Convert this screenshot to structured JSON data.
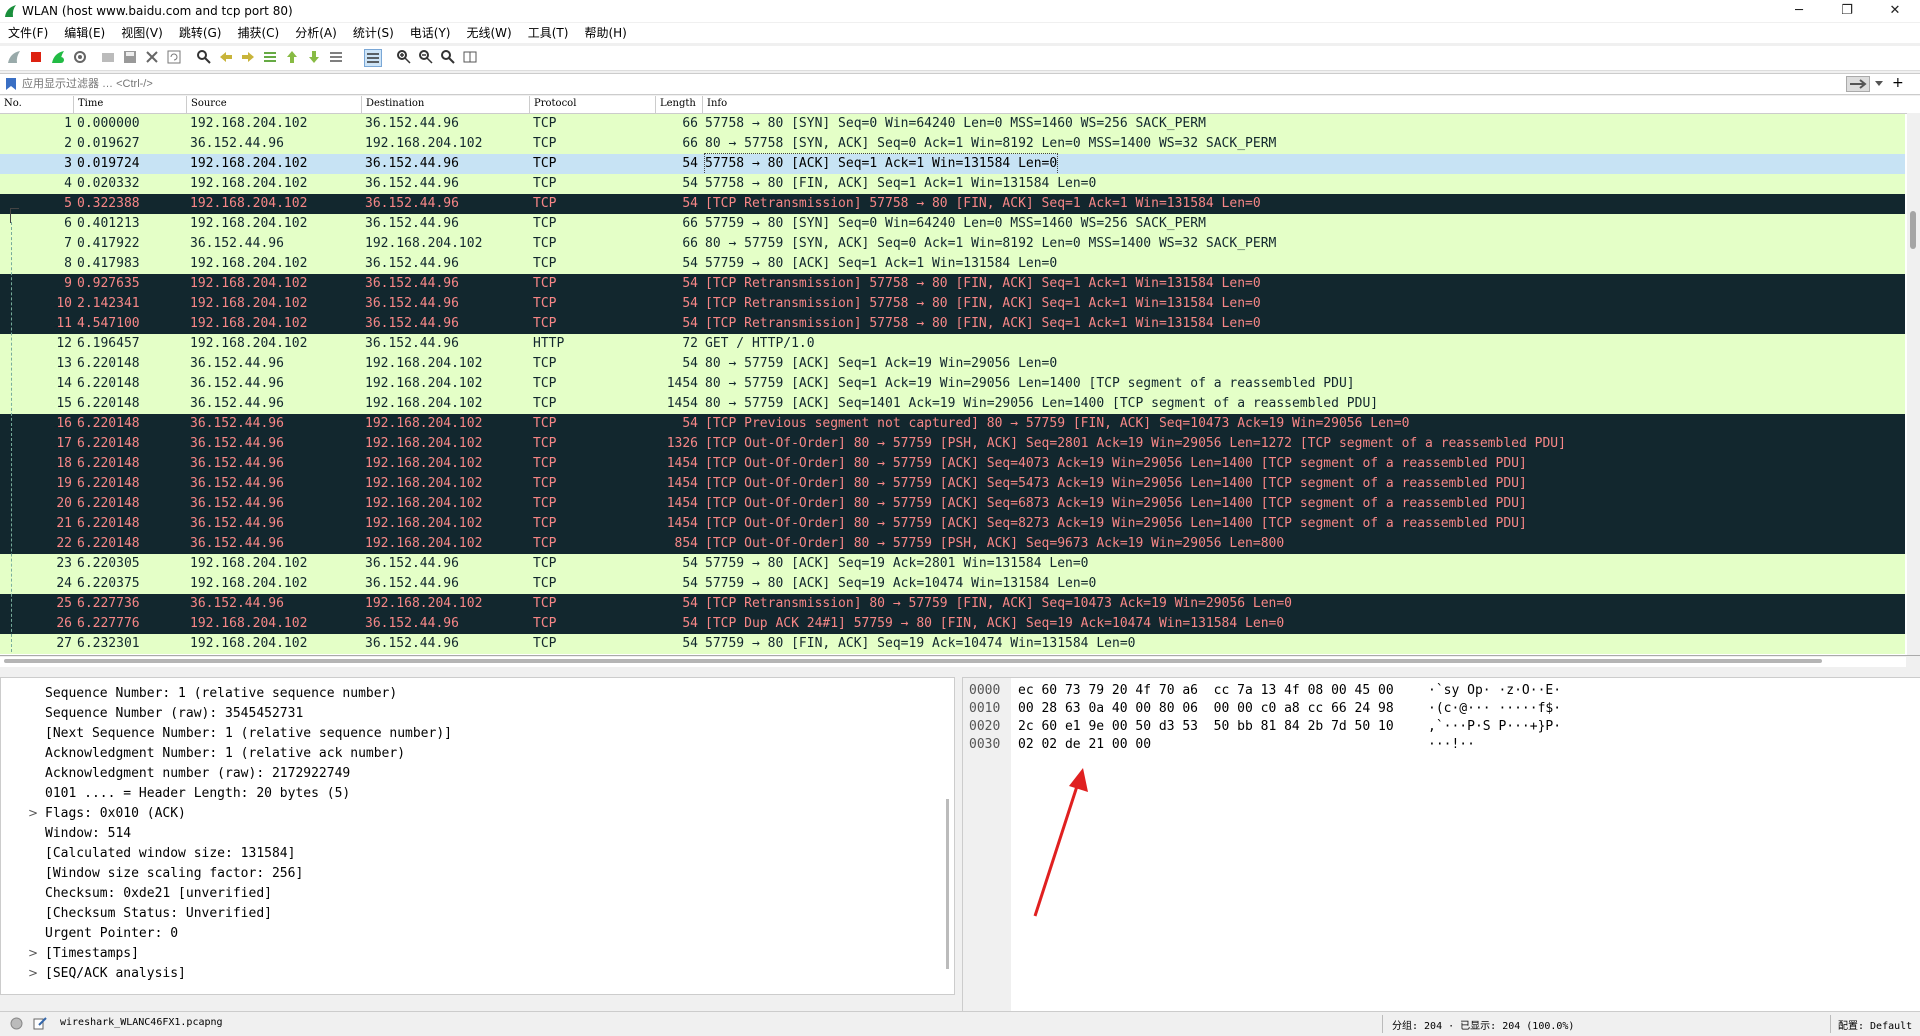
{
  "window": {
    "title": "WLAN (host www.baidu.com and tcp port 80)",
    "minimize": "─",
    "maximize": "❐",
    "close": "✕"
  },
  "menu": [
    "文件(F)",
    "编辑(E)",
    "视图(V)",
    "跳转(G)",
    "捕获(C)",
    "分析(A)",
    "统计(S)",
    "电话(Y)",
    "无线(W)",
    "工具(T)",
    "帮助(H)"
  ],
  "filter": {
    "placeholder": "应用显示过滤器 … <Ctrl-/>",
    "apply_icon": "arrow-right-icon",
    "add": "+"
  },
  "columns": [
    "No.",
    "Time",
    "Source",
    "Destination",
    "Protocol",
    "Length",
    "Info"
  ],
  "packets": [
    {
      "no": "1",
      "time": "0.000000",
      "src": "192.168.204.102",
      "dst": "36.152.44.96",
      "proto": "TCP",
      "len": "66",
      "info": "57758 → 80 [SYN] Seq=0 Win=64240 Len=0 MSS=1460 WS=256 SACK_PERM",
      "type": "ok"
    },
    {
      "no": "2",
      "time": "0.019627",
      "src": "36.152.44.96",
      "dst": "192.168.204.102",
      "proto": "TCP",
      "len": "66",
      "info": "80 → 57758 [SYN, ACK] Seq=0 Ack=1 Win=8192 Len=0 MSS=1400 WS=32 SACK_PERM",
      "type": "ok"
    },
    {
      "no": "3",
      "time": "0.019724",
      "src": "192.168.204.102",
      "dst": "36.152.44.96",
      "proto": "TCP",
      "len": "54",
      "info": "57758 → 80 [ACK] Seq=1 Ack=1 Win=131584 Len=0",
      "type": "ok",
      "selected": true
    },
    {
      "no": "4",
      "time": "0.020332",
      "src": "192.168.204.102",
      "dst": "36.152.44.96",
      "proto": "TCP",
      "len": "54",
      "info": "57758 → 80 [FIN, ACK] Seq=1 Ack=1 Win=131584 Len=0",
      "type": "ok"
    },
    {
      "no": "5",
      "time": "0.322388",
      "src": "192.168.204.102",
      "dst": "36.152.44.96",
      "proto": "TCP",
      "len": "54",
      "info": "[TCP Retransmission] 57758 → 80 [FIN, ACK] Seq=1 Ack=1 Win=131584 Len=0",
      "type": "bad"
    },
    {
      "no": "6",
      "time": "0.401213",
      "src": "192.168.204.102",
      "dst": "36.152.44.96",
      "proto": "TCP",
      "len": "66",
      "info": "57759 → 80 [SYN] Seq=0 Win=64240 Len=0 MSS=1460 WS=256 SACK_PERM",
      "type": "ok"
    },
    {
      "no": "7",
      "time": "0.417922",
      "src": "36.152.44.96",
      "dst": "192.168.204.102",
      "proto": "TCP",
      "len": "66",
      "info": "80 → 57759 [SYN, ACK] Seq=0 Ack=1 Win=8192 Len=0 MSS=1400 WS=32 SACK_PERM",
      "type": "ok"
    },
    {
      "no": "8",
      "time": "0.417983",
      "src": "192.168.204.102",
      "dst": "36.152.44.96",
      "proto": "TCP",
      "len": "54",
      "info": "57759 → 80 [ACK] Seq=1 Ack=1 Win=131584 Len=0",
      "type": "ok"
    },
    {
      "no": "9",
      "time": "0.927635",
      "src": "192.168.204.102",
      "dst": "36.152.44.96",
      "proto": "TCP",
      "len": "54",
      "info": "[TCP Retransmission] 57758 → 80 [FIN, ACK] Seq=1 Ack=1 Win=131584 Len=0",
      "type": "bad"
    },
    {
      "no": "10",
      "time": "2.142341",
      "src": "192.168.204.102",
      "dst": "36.152.44.96",
      "proto": "TCP",
      "len": "54",
      "info": "[TCP Retransmission] 57758 → 80 [FIN, ACK] Seq=1 Ack=1 Win=131584 Len=0",
      "type": "bad"
    },
    {
      "no": "11",
      "time": "4.547100",
      "src": "192.168.204.102",
      "dst": "36.152.44.96",
      "proto": "TCP",
      "len": "54",
      "info": "[TCP Retransmission] 57758 → 80 [FIN, ACK] Seq=1 Ack=1 Win=131584 Len=0",
      "type": "bad"
    },
    {
      "no": "12",
      "time": "6.196457",
      "src": "192.168.204.102",
      "dst": "36.152.44.96",
      "proto": "HTTP",
      "len": "72",
      "info": "GET / HTTP/1.0",
      "type": "ok"
    },
    {
      "no": "13",
      "time": "6.220148",
      "src": "36.152.44.96",
      "dst": "192.168.204.102",
      "proto": "TCP",
      "len": "54",
      "info": "80 → 57759 [ACK] Seq=1 Ack=19 Win=29056 Len=0",
      "type": "ok"
    },
    {
      "no": "14",
      "time": "6.220148",
      "src": "36.152.44.96",
      "dst": "192.168.204.102",
      "proto": "TCP",
      "len": "1454",
      "info": "80 → 57759 [ACK] Seq=1 Ack=19 Win=29056 Len=1400 [TCP segment of a reassembled PDU]",
      "type": "ok"
    },
    {
      "no": "15",
      "time": "6.220148",
      "src": "36.152.44.96",
      "dst": "192.168.204.102",
      "proto": "TCP",
      "len": "1454",
      "info": "80 → 57759 [ACK] Seq=1401 Ack=19 Win=29056 Len=1400 [TCP segment of a reassembled PDU]",
      "type": "ok"
    },
    {
      "no": "16",
      "time": "6.220148",
      "src": "36.152.44.96",
      "dst": "192.168.204.102",
      "proto": "TCP",
      "len": "54",
      "info": "[TCP Previous segment not captured] 80 → 57759 [FIN, ACK] Seq=10473 Ack=19 Win=29056 Len=0",
      "type": "bad"
    },
    {
      "no": "17",
      "time": "6.220148",
      "src": "36.152.44.96",
      "dst": "192.168.204.102",
      "proto": "TCP",
      "len": "1326",
      "info": "[TCP Out-Of-Order] 80 → 57759 [PSH, ACK] Seq=2801 Ack=19 Win=29056 Len=1272 [TCP segment of a reassembled PDU]",
      "type": "bad"
    },
    {
      "no": "18",
      "time": "6.220148",
      "src": "36.152.44.96",
      "dst": "192.168.204.102",
      "proto": "TCP",
      "len": "1454",
      "info": "[TCP Out-Of-Order] 80 → 57759 [ACK] Seq=4073 Ack=19 Win=29056 Len=1400 [TCP segment of a reassembled PDU]",
      "type": "bad"
    },
    {
      "no": "19",
      "time": "6.220148",
      "src": "36.152.44.96",
      "dst": "192.168.204.102",
      "proto": "TCP",
      "len": "1454",
      "info": "[TCP Out-Of-Order] 80 → 57759 [ACK] Seq=5473 Ack=19 Win=29056 Len=1400 [TCP segment of a reassembled PDU]",
      "type": "bad"
    },
    {
      "no": "20",
      "time": "6.220148",
      "src": "36.152.44.96",
      "dst": "192.168.204.102",
      "proto": "TCP",
      "len": "1454",
      "info": "[TCP Out-Of-Order] 80 → 57759 [ACK] Seq=6873 Ack=19 Win=29056 Len=1400 [TCP segment of a reassembled PDU]",
      "type": "bad"
    },
    {
      "no": "21",
      "time": "6.220148",
      "src": "36.152.44.96",
      "dst": "192.168.204.102",
      "proto": "TCP",
      "len": "1454",
      "info": "[TCP Out-Of-Order] 80 → 57759 [ACK] Seq=8273 Ack=19 Win=29056 Len=1400 [TCP segment of a reassembled PDU]",
      "type": "bad"
    },
    {
      "no": "22",
      "time": "6.220148",
      "src": "36.152.44.96",
      "dst": "192.168.204.102",
      "proto": "TCP",
      "len": "854",
      "info": "[TCP Out-Of-Order] 80 → 57759 [PSH, ACK] Seq=9673 Ack=19 Win=29056 Len=800",
      "type": "bad"
    },
    {
      "no": "23",
      "time": "6.220305",
      "src": "192.168.204.102",
      "dst": "36.152.44.96",
      "proto": "TCP",
      "len": "54",
      "info": "57759 → 80 [ACK] Seq=19 Ack=2801 Win=131584 Len=0",
      "type": "ok"
    },
    {
      "no": "24",
      "time": "6.220375",
      "src": "192.168.204.102",
      "dst": "36.152.44.96",
      "proto": "TCP",
      "len": "54",
      "info": "57759 → 80 [ACK] Seq=19 Ack=10474 Win=131584 Len=0",
      "type": "ok"
    },
    {
      "no": "25",
      "time": "6.227736",
      "src": "36.152.44.96",
      "dst": "192.168.204.102",
      "proto": "TCP",
      "len": "54",
      "info": "[TCP Retransmission] 80 → 57759 [FIN, ACK] Seq=10473 Ack=19 Win=29056 Len=0",
      "type": "bad"
    },
    {
      "no": "26",
      "time": "6.227776",
      "src": "192.168.204.102",
      "dst": "36.152.44.96",
      "proto": "TCP",
      "len": "54",
      "info": "[TCP Dup ACK 24#1] 57759 → 80 [FIN, ACK] Seq=19 Ack=10474 Win=131584 Len=0",
      "type": "bad"
    },
    {
      "no": "27",
      "time": "6.232301",
      "src": "192.168.204.102",
      "dst": "36.152.44.96",
      "proto": "TCP",
      "len": "54",
      "info": "57759 → 80 [FIN, ACK] Seq=19 Ack=10474 Win=131584 Len=0",
      "type": "ok"
    }
  ],
  "details": [
    {
      "text": "Sequence Number: 1    (relative sequence number)",
      "expand": ""
    },
    {
      "text": "Sequence Number (raw): 3545452731",
      "expand": ""
    },
    {
      "text": "[Next Sequence Number: 1    (relative sequence number)]",
      "expand": ""
    },
    {
      "text": "Acknowledgment Number: 1    (relative ack number)",
      "expand": ""
    },
    {
      "text": "Acknowledgment number (raw): 2172922749",
      "expand": ""
    },
    {
      "text": "0101 .... = Header Length: 20 bytes (5)",
      "expand": ""
    },
    {
      "text": "Flags: 0x010 (ACK)",
      "expand": ">"
    },
    {
      "text": "Window: 514",
      "expand": ""
    },
    {
      "text": "[Calculated window size: 131584]",
      "expand": ""
    },
    {
      "text": "[Window size scaling factor: 256]",
      "expand": ""
    },
    {
      "text": "Checksum: 0xde21 [unverified]",
      "expand": ""
    },
    {
      "text": "[Checksum Status: Unverified]",
      "expand": ""
    },
    {
      "text": "Urgent Pointer: 0",
      "expand": ""
    },
    {
      "text": "[Timestamps]",
      "expand": ">"
    },
    {
      "text": "[SEQ/ACK analysis]",
      "expand": ">"
    }
  ],
  "bytes": [
    {
      "offset": "0000",
      "hex": "ec 60 73 79 20 4f 70 a6  cc 7a 13 4f 08 00 45 00",
      "ascii": "·`sy Op· ·z·O··E·"
    },
    {
      "offset": "0010",
      "hex": "00 28 63 0a 40 00 80 06  00 00 c0 a8 cc 66 24 98",
      "ascii": "·(c·@··· ·····f$·"
    },
    {
      "offset": "0020",
      "hex": "2c 60 e1 9e 00 50 d3 53  50 bb 81 84 2b 7d 50 10",
      "ascii": ",`···P·S P···+}P·"
    },
    {
      "offset": "0030",
      "hex": "02 02 de 21 00 00",
      "ascii": "···!··"
    }
  ],
  "status": {
    "file": "wireshark_WLANC46FX1.pcapng",
    "packets": "分组: 204 · 已显示: 204 (100.0%)",
    "profile": "配置: Default"
  },
  "colors": {
    "ok_bg": "#e4ffc7",
    "bad_bg": "#12272e",
    "bad_fg": "#f78787",
    "selected_bg": "#c7e3f4",
    "annotation_arrow": "#e02020"
  }
}
